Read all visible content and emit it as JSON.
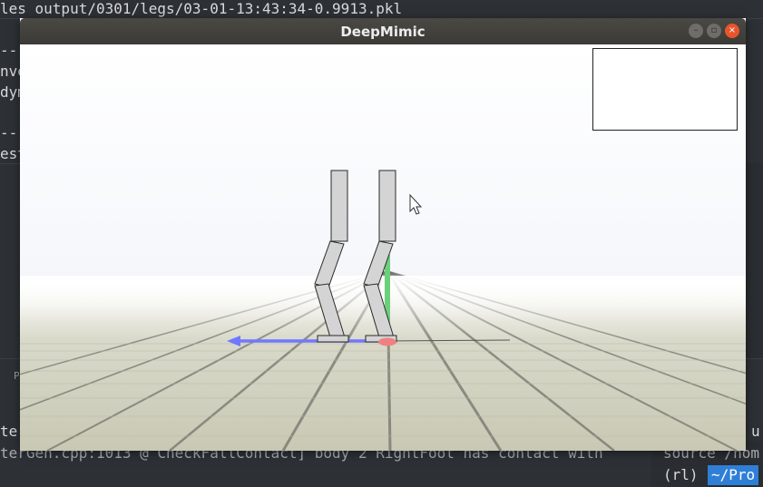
{
  "terminal": {
    "line_top": "les output/0301/legs/03-01-13:43:34-0.9913.pkl",
    "frag_1": "---",
    "frag_2": "nve",
    "frag_3": "dym",
    "frag_4": "---",
    "frag_5": "est",
    "frag_p": "P",
    "frag_6": "ter",
    "frag_u": "u",
    "line_bottom": "terGen.cpp:1013 @ CheckFallContact] body 2 RightFoot has contact with",
    "line_source": "source /hom",
    "prompt_env": "(rl)",
    "prompt_path": "~/Pro"
  },
  "window": {
    "title": "DeepMimic",
    "minimize_glyph": "–",
    "maximize_glyph": "▫",
    "close_glyph": "×"
  },
  "colors": {
    "close_button": "#e8552c",
    "axis_x": "#6f78ff",
    "axis_y": "#6bd07a",
    "contact_marker": "#f08080",
    "prompt_highlight": "#2f7fd6"
  }
}
